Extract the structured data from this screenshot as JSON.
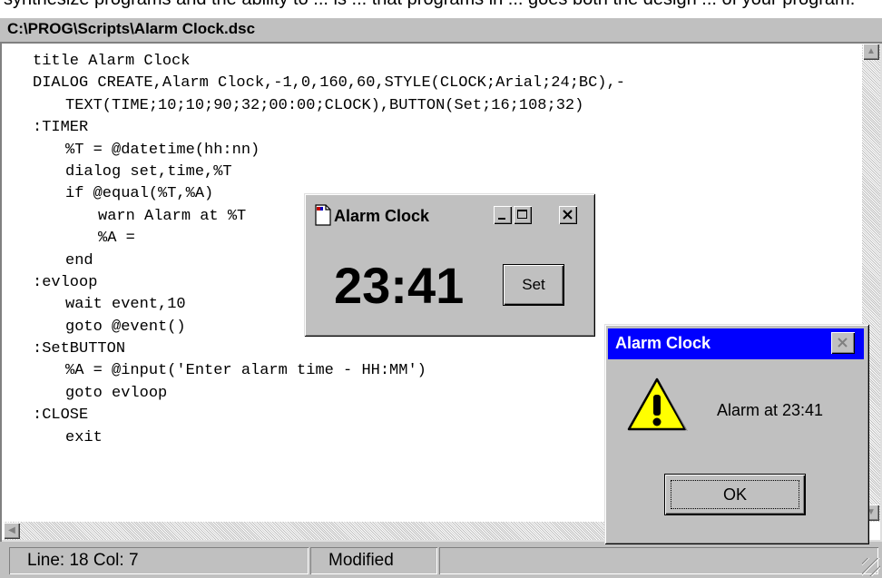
{
  "banner_text": "synthesize programs and the ability to ... is ... that programs in ... goes both the design ... of your program.",
  "editor": {
    "title": "C:\\PROG\\Scripts\\Alarm Clock.dsc",
    "lines": [
      {
        "text": "title Alarm Clock",
        "indent": 0
      },
      {
        "text": "DIALOG CREATE,Alarm Clock,-1,0,160,60,STYLE(CLOCK;Arial;24;BC),-",
        "indent": 0
      },
      {
        "text": "TEXT(TIME;10;10;90;32;00:00;CLOCK),BUTTON(Set;16;108;32)",
        "indent": 1
      },
      {
        "text": ":TIMER",
        "indent": 0
      },
      {
        "text": "%T = @datetime(hh:nn)",
        "indent": 1
      },
      {
        "text": "dialog set,time,%T",
        "indent": 1
      },
      {
        "text": "if @equal(%T,%A)",
        "indent": 1
      },
      {
        "text": "warn Alarm at %T",
        "indent": 2
      },
      {
        "text": "%A =",
        "indent": 2
      },
      {
        "text": "end",
        "indent": 1
      },
      {
        "text": ":evloop",
        "indent": 0
      },
      {
        "text": "wait event,10",
        "indent": 1
      },
      {
        "text": "goto @event()",
        "indent": 1
      },
      {
        "text": ":SetBUTTON",
        "indent": 0
      },
      {
        "text": "%A = @input('Enter alarm time - HH:MM')",
        "indent": 1
      },
      {
        "text": "goto evloop",
        "indent": 1
      },
      {
        "text": ":CLOSE",
        "indent": 0
      },
      {
        "text": "exit",
        "indent": 1
      }
    ]
  },
  "status": {
    "position": "Line: 18  Col: 7",
    "state": "Modified"
  },
  "clock_window": {
    "title": "Alarm Clock",
    "time": "23:41",
    "button_label": "Set"
  },
  "message_box": {
    "title": "Alarm Clock",
    "message": "Alarm at 23:41",
    "ok_label": "OK"
  },
  "colors": {
    "face": "#c0c0c0",
    "msg_titlebar": "#0000ff",
    "warning_yellow": "#ffff00"
  }
}
